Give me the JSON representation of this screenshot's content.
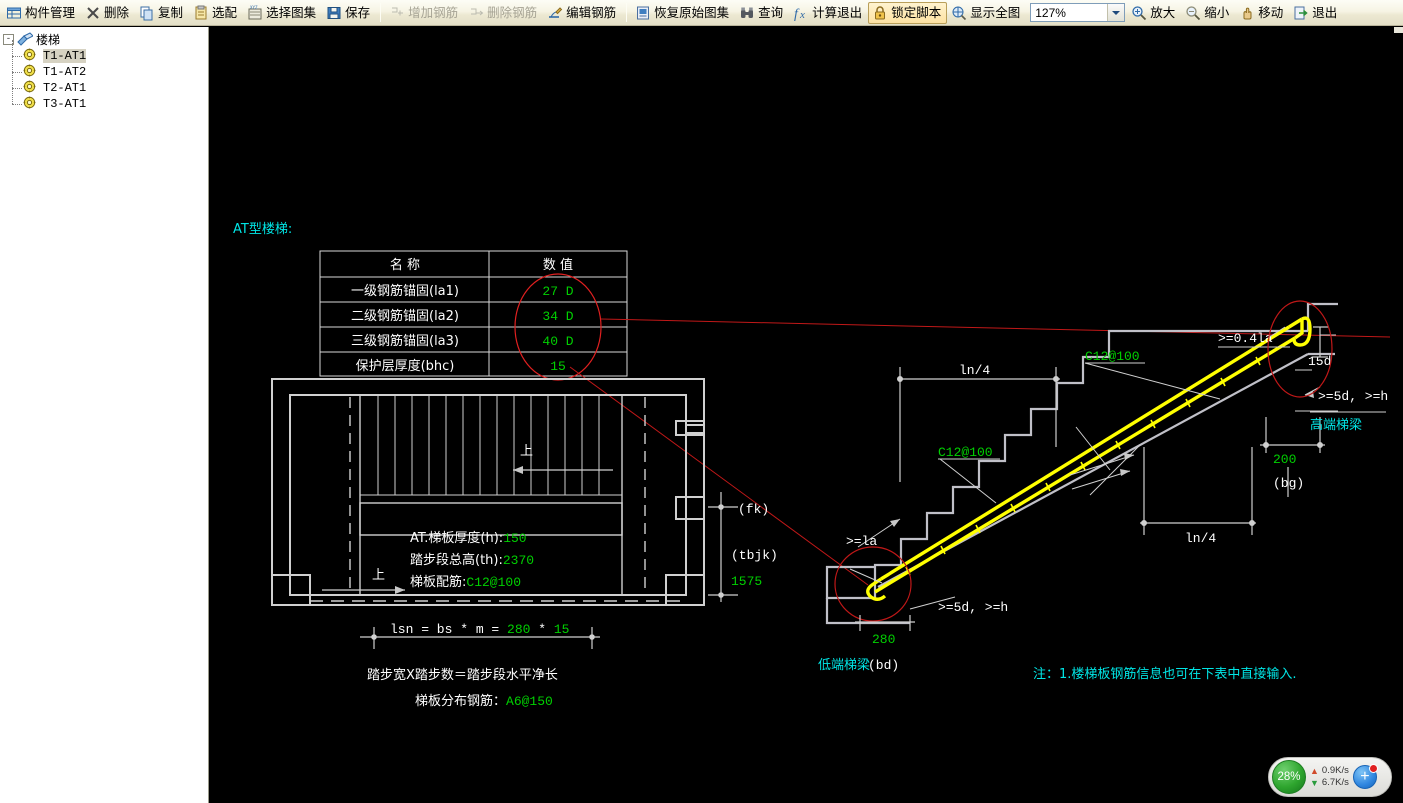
{
  "toolbar": {
    "items": [
      {
        "label": "构件管理",
        "icon": "component-manager-icon",
        "state": "normal"
      },
      {
        "label": "删除",
        "icon": "delete-x-icon",
        "state": "normal"
      },
      {
        "label": "复制",
        "icon": "copy-icon",
        "state": "normal"
      },
      {
        "label": "选配",
        "icon": "match-icon",
        "state": "normal"
      },
      {
        "label": "选择图集",
        "icon": "select-atlas-icon",
        "state": "normal"
      },
      {
        "label": "保存",
        "icon": "save-disk-icon",
        "state": "normal"
      },
      {
        "label": "增加钢筋",
        "icon": "add-rebar-icon",
        "state": "disabled"
      },
      {
        "label": "删除钢筋",
        "icon": "remove-rebar-icon",
        "state": "disabled"
      },
      {
        "label": "编辑钢筋",
        "icon": "edit-rebar-icon",
        "state": "normal"
      },
      {
        "label": "恢复原始图集",
        "icon": "restore-atlas-icon",
        "state": "normal"
      },
      {
        "label": "查询",
        "icon": "binoculars-icon",
        "state": "normal"
      },
      {
        "label": "计算退出",
        "icon": "calc-exit-icon",
        "state": "normal"
      },
      {
        "label": "锁定脚本",
        "icon": "lock-icon",
        "state": "pressed"
      },
      {
        "label": "显示全图",
        "icon": "fit-view-icon",
        "state": "normal"
      },
      {
        "label": "放大",
        "icon": "zoom-in-icon",
        "state": "normal"
      },
      {
        "label": "缩小",
        "icon": "zoom-out-icon",
        "state": "normal"
      },
      {
        "label": "移动",
        "icon": "pan-hand-icon",
        "state": "normal"
      },
      {
        "label": "退出",
        "icon": "exit-icon",
        "state": "normal"
      }
    ],
    "zoom_value": "127%"
  },
  "sidebar": {
    "root": {
      "label": "楼梯",
      "expander": "-",
      "icon": "stair-group-icon"
    },
    "items": [
      {
        "label": "T1-AT1",
        "selected": true
      },
      {
        "label": "T1-AT2",
        "selected": false
      },
      {
        "label": "T2-AT1",
        "selected": false
      },
      {
        "label": "T3-AT1",
        "selected": false
      }
    ]
  },
  "drawing": {
    "title": "AT型楼梯:",
    "param_table": {
      "headers": [
        "名  称",
        "数  值"
      ],
      "rows": [
        {
          "name": "一级钢筋锚固(la1)",
          "value": "27 D"
        },
        {
          "name": "二级钢筋锚固(la2)",
          "value": "34 D"
        },
        {
          "name": "三级钢筋锚固(la3)",
          "value": "40 D"
        },
        {
          "name": "保护层厚度(bhc)",
          "value": "15"
        }
      ]
    },
    "plan": {
      "up_marker_top": "上",
      "up_marker_bottom": "上",
      "note_lines": [
        {
          "label": "AT.梯板厚度(h):",
          "value": "150"
        },
        {
          "label": "踏步段总高(th):",
          "value": "2370"
        },
        {
          "label": "梯板配筋:",
          "value": "C12@100"
        }
      ],
      "dim_formula_prefix": "lsn = bs * m = ",
      "dim_formula_v1": "280",
      "dim_formula_mid": " * ",
      "dim_formula_v2": "15",
      "dim_caption": "踏步宽X踏步数＝踏步段水平净长",
      "distribution_label": "梯板分布钢筋：",
      "distribution_value": "A6@150"
    },
    "section": {
      "fk_label": "(fk)",
      "tbjk_label": "(tbjk)",
      "tbjk_value": "1575",
      "ln4_top": "ln/4",
      "ln4_bottom": "ln/4",
      "rebar_top_label": "C12@100",
      "rebar_mid_label": "C12@100",
      "anchor_la": ">=la",
      "anchor_5d_low": ">=5d, >=h",
      "anchor_5d_high": ">=5d, >=h",
      "anchor_04la": ">=0.4la",
      "bend_15d": "15d",
      "dim_280": "280",
      "dim_200": "200",
      "bg_label": "(bg)",
      "low_beam_label": "低端梯梁",
      "low_beam_code": "(bd)",
      "high_beam_label": "高端梯梁"
    },
    "footnote": "注：1.楼梯板钢筋信息也可在下表中直接输入."
  },
  "net_widget": {
    "percent": "28%",
    "upload_rate": "0.9K/s",
    "download_rate": "6.7K/s",
    "plus_glyph": "+"
  },
  "colors": {
    "canvas_bg": "#000000",
    "line_white": "#ffffff",
    "value_green": "#00d000",
    "label_cyan": "#00e5e5",
    "annotation_red": "#ff2d2d",
    "rebar_yellow": "#ffff00",
    "concrete_grey": "#c0c0c8"
  }
}
